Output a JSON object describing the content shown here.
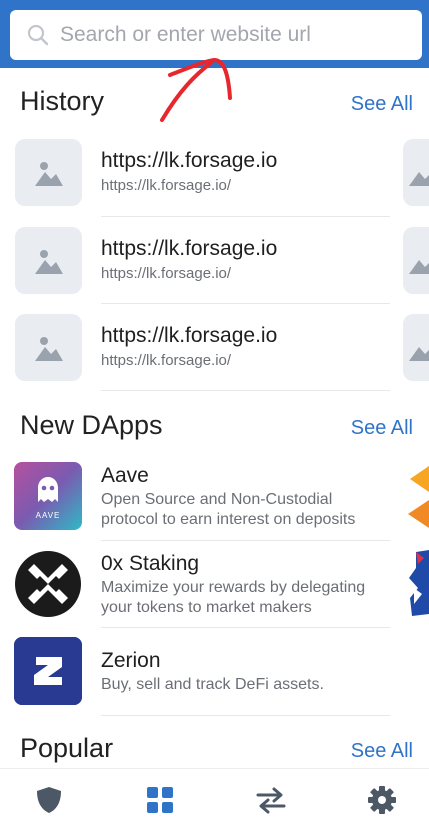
{
  "search": {
    "placeholder": "Search or enter website url",
    "icon": "search-icon"
  },
  "history": {
    "title": "History",
    "see_all": "See All",
    "items": [
      {
        "title": "https://lk.forsage.io",
        "url": "https://lk.forsage.io/"
      },
      {
        "title": "https://lk.forsage.io",
        "url": "https://lk.forsage.io/"
      },
      {
        "title": "https://lk.forsage.io",
        "url": "https://lk.forsage.io/"
      }
    ]
  },
  "new_dapps": {
    "title": "New DApps",
    "see_all": "See All",
    "items": [
      {
        "name": "Aave",
        "description": "Open Source and Non-Custodial protocol to earn interest on deposits",
        "icon_text": "AAVE"
      },
      {
        "name": "0x Staking",
        "description": "Maximize your rewards by delegating your tokens to market makers"
      },
      {
        "name": "Zerion",
        "description": "Buy, sell and track DeFi assets."
      }
    ]
  },
  "popular": {
    "title": "Popular",
    "see_all": "See All"
  },
  "bottom_nav": [
    {
      "name": "wallet",
      "icon": "shield-icon"
    },
    {
      "name": "browser",
      "icon": "grid-icon",
      "active": true
    },
    {
      "name": "swap",
      "icon": "swap-arrows-icon"
    },
    {
      "name": "settings",
      "icon": "gear-icon"
    }
  ],
  "colors": {
    "accent": "#2f74c8",
    "nav_inactive": "#4c5866",
    "thumb_bg": "#e9edf2",
    "annotation": "#e8262d"
  }
}
